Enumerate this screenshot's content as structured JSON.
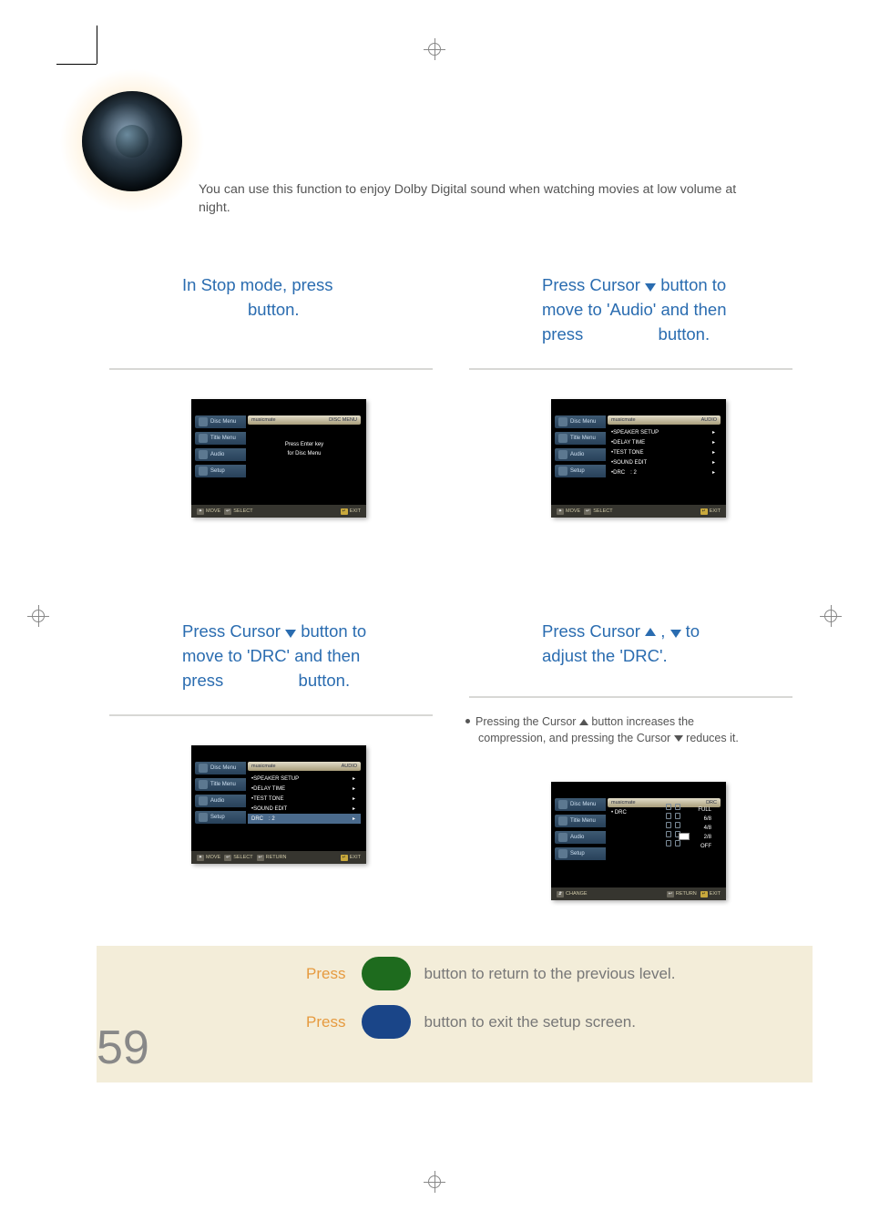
{
  "intro": "You can use this function to enjoy Dolby Digital sound when watching movies at low volume at night.",
  "steps": {
    "s1": {
      "line1": "In Stop mode, press",
      "line2_suffix": "button.",
      "preview": {
        "header_left": "musicmate",
        "header_right": "DISC MENU",
        "sidebar": [
          "Disc Menu",
          "Title Menu",
          "Audio",
          "Setup"
        ],
        "content_lines": [
          "Press Enter key",
          "for Disc Menu"
        ],
        "bottom": {
          "move": "MOVE",
          "select": "SELECT",
          "exit": "EXIT"
        }
      }
    },
    "s2": {
      "line1_a": "Press Cursor ",
      "line1_b": " button to",
      "line2": "move to 'Audio' and then",
      "line3_a": "press",
      "line3_b": "button.",
      "preview": {
        "header_left": "musicmate",
        "header_right": "AUDIO",
        "sidebar": [
          "Disc Menu",
          "Title Menu",
          "Audio",
          "Setup"
        ],
        "menu": [
          {
            "label": "SPEAKER SETUP",
            "value": ""
          },
          {
            "label": "DELAY TIME",
            "value": ""
          },
          {
            "label": "TEST TONE",
            "value": ""
          },
          {
            "label": "SOUND EDIT",
            "value": ""
          },
          {
            "label": "DRC",
            "value": ": 2"
          }
        ],
        "bottom": {
          "move": "MOVE",
          "select": "SELECT",
          "exit": "EXIT"
        }
      }
    },
    "s3": {
      "line1_a": "Press Cursor ",
      "line1_b": " button to",
      "line2": "move to 'DRC' and then",
      "line3_a": "press",
      "line3_b": "button.",
      "preview": {
        "header_left": "musicmate",
        "header_right": "AUDIO",
        "sidebar": [
          "Disc Menu",
          "Title Menu",
          "Audio",
          "Setup"
        ],
        "menu": [
          {
            "label": "SPEAKER SETUP",
            "value": ""
          },
          {
            "label": "DELAY TIME",
            "value": ""
          },
          {
            "label": "TEST TONE",
            "value": ""
          },
          {
            "label": "SOUND EDIT",
            "value": ""
          },
          {
            "label": "DRC",
            "value": ": 2",
            "hl": true
          }
        ],
        "bottom": {
          "move": "MOVE",
          "select": "SELECT",
          "return": "RETURN",
          "exit": "EXIT"
        }
      }
    },
    "s4": {
      "line1_a": "Press Cursor",
      "line1_b": " ,",
      "line1_c": "   to",
      "line2": "adjust the 'DRC'.",
      "note_a": "Pressing the Cursor ",
      "note_b": " button increases the",
      "note_c": "compression, and pressing the Cursor ",
      "note_d": " reduces it.",
      "preview": {
        "header_left": "musicmate",
        "header_right": "DRC",
        "sidebar": [
          "Disc Menu",
          "Title Menu",
          "Audio",
          "Setup"
        ],
        "drc_label": "DRC",
        "levels": [
          "FULL",
          "6/8",
          "4/8",
          "2/8",
          "OFF"
        ],
        "bottom": {
          "change": "CHANGE",
          "return": "RETURN",
          "exit": "EXIT"
        }
      }
    }
  },
  "footer": {
    "row1": {
      "lead": "Press",
      "tail": "button to return to the previous level."
    },
    "row2": {
      "lead": "Press",
      "tail": "button to exit the setup screen."
    }
  },
  "page_number": "59"
}
